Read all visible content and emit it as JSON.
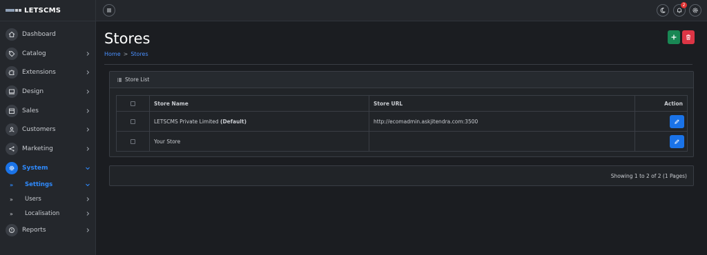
{
  "brand": {
    "name": "LETSCMS"
  },
  "sidebar": {
    "items": [
      {
        "label": "Dashboard",
        "icon": "home-icon"
      },
      {
        "label": "Catalog",
        "icon": "tag-icon"
      },
      {
        "label": "Extensions",
        "icon": "puzzle-icon"
      },
      {
        "label": "Design",
        "icon": "monitor-icon"
      },
      {
        "label": "Sales",
        "icon": "store-icon"
      },
      {
        "label": "Customers",
        "icon": "user-icon"
      },
      {
        "label": "Marketing",
        "icon": "share-icon"
      },
      {
        "label": "System",
        "icon": "gear-icon"
      },
      {
        "label": "Reports",
        "icon": "alert-icon"
      }
    ],
    "system_sub": [
      {
        "label": "Settings"
      },
      {
        "label": "Users"
      },
      {
        "label": "Localisation"
      }
    ],
    "bullet": "»"
  },
  "topbar": {
    "notification_count": "2"
  },
  "page": {
    "title": "Stores",
    "breadcrumb": [
      "Home",
      "Stores"
    ],
    "breadcrumb_sep": ">"
  },
  "store_list": {
    "heading": "Store List",
    "columns": {
      "name": "Store Name",
      "url": "Store URL",
      "action": "Action"
    },
    "rows": [
      {
        "name": "LETSCMS Private Limited",
        "default_tag": "(Default)",
        "url": "http://ecomadmin.askjitendra.com:3500"
      },
      {
        "name": "Your Store",
        "default_tag": "",
        "url": ""
      }
    ]
  },
  "pagination": {
    "text": "Showing 1 to 2 of 2 (1 Pages)"
  },
  "colors": {
    "accent": "#1a73e8",
    "add": "#198754",
    "delete": "#dc3545"
  }
}
